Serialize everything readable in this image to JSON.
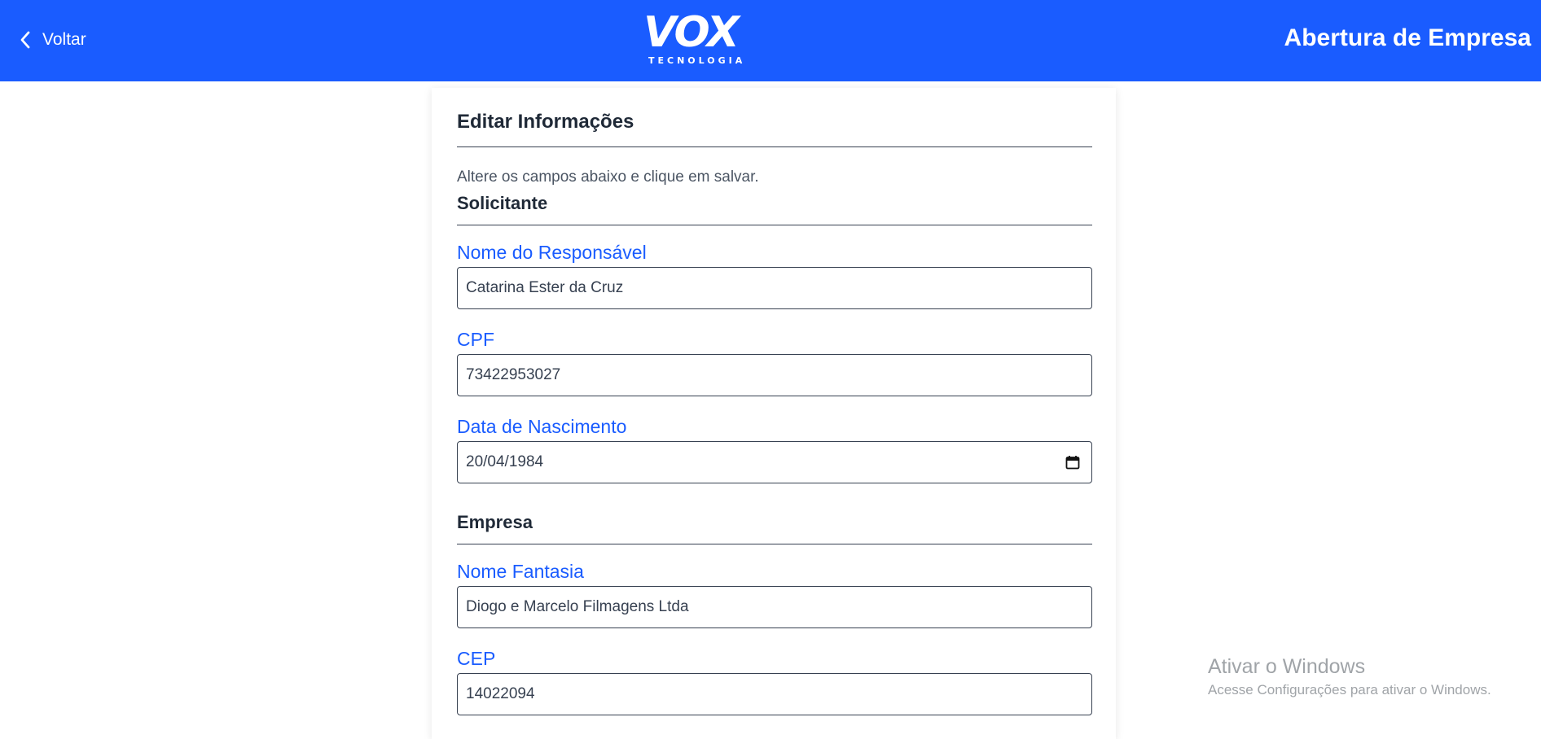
{
  "header": {
    "back_label": "Voltar",
    "logo_main": "VOX",
    "logo_sub": "TECNOLOGIA",
    "title": "Abertura de Empresa",
    "background_color": "#1a5cff"
  },
  "form": {
    "title": "Editar Informações",
    "help_text": "Altere os campos abaixo e clique em salvar.",
    "sections": {
      "requester": {
        "title": "Solicitante",
        "fields": {
          "responsible_name": {
            "label": "Nome do Responsável",
            "value": "Catarina Ester da Cruz"
          },
          "cpf": {
            "label": "CPF",
            "value": "73422953027"
          },
          "birth_date": {
            "label": "Data de Nascimento",
            "value": "20/04/1984",
            "icon": "calendar-icon"
          }
        }
      },
      "company": {
        "title": "Empresa",
        "fields": {
          "trade_name": {
            "label": "Nome Fantasia",
            "value": "Diogo e Marcelo Filmagens Ltda"
          },
          "cep": {
            "label": "CEP",
            "value": "14022094"
          }
        }
      }
    },
    "label_color": "#1a5cff"
  },
  "watermark": {
    "title": "Ativar o Windows",
    "subtitle": "Acesse Configurações para ativar o Windows."
  }
}
